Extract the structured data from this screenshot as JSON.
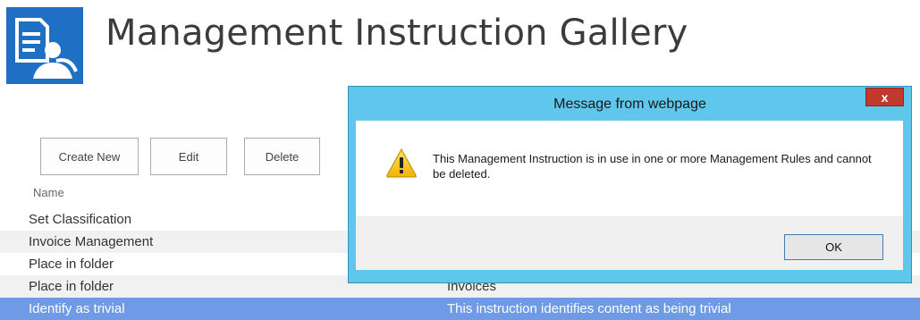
{
  "page": {
    "title": "Management Instruction Gallery"
  },
  "toolbar": {
    "create_label": "Create New",
    "edit_label": "Edit",
    "delete_label": "Delete"
  },
  "list": {
    "column_name": "Name",
    "rows": [
      {
        "name": "Set Classification",
        "description": ""
      },
      {
        "name": "Invoice Management",
        "description": ""
      },
      {
        "name": "Place in folder",
        "description": ""
      },
      {
        "name": "Place in folder",
        "description": "Invoices"
      },
      {
        "name": "Identify as trivial",
        "description": "This instruction identifies content as being trivial"
      }
    ]
  },
  "dialog": {
    "title": "Message from webpage",
    "close_label": "x",
    "message": "This Management Instruction is in use in one or more Management Rules and cannot be deleted.",
    "ok_label": "OK",
    "icon": "warning-icon"
  },
  "colors": {
    "dialog_frame": "#5fc6ec",
    "selected_row": "#6f9ae6",
    "app_icon": "#1f6fc5"
  }
}
